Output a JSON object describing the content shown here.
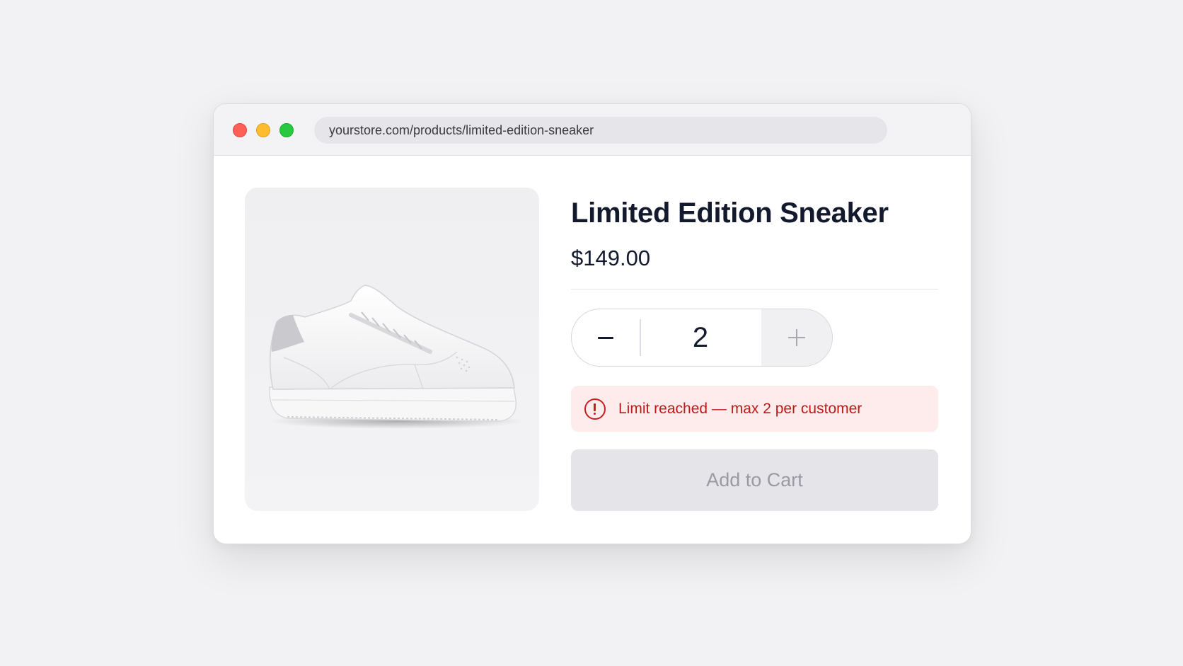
{
  "browser": {
    "url": "yourstore.com/products/limited-edition-sneaker",
    "controls": [
      "close",
      "minimize",
      "maximize"
    ]
  },
  "product": {
    "title": "Limited Edition Sneaker",
    "price": "$149.00",
    "image_icon": "sneaker-image"
  },
  "quantity": {
    "value": "2",
    "decrement_icon": "minus-icon",
    "increment_icon": "plus-icon",
    "increment_disabled": true
  },
  "alert": {
    "icon": "alert-circle-icon",
    "message": "Limit reached — max 2 per customer",
    "color": "#c0191a",
    "background": "#fdeceb"
  },
  "cart": {
    "button_label": "Add to Cart",
    "disabled": true
  },
  "colors": {
    "text_primary": "#141a2e",
    "close": "#ff5f57",
    "minimize": "#febc2e",
    "maximize": "#28c840"
  }
}
